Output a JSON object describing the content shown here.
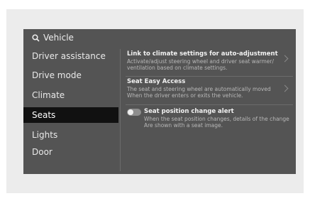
{
  "header": {
    "title": "Vehicle",
    "search_icon": "search-icon"
  },
  "sidebar": {
    "selected_index": 3,
    "items": [
      {
        "label": "Driver assistance"
      },
      {
        "label": "Drive mode"
      },
      {
        "label": "Climate"
      },
      {
        "label": "Seats"
      },
      {
        "label": "Lights"
      },
      {
        "label": "Door"
      }
    ]
  },
  "settings": [
    {
      "title": "Link to climate settings for auto-adjustment",
      "desc1": "Activate/adjust steering wheel and driver seat warmer/",
      "desc2": "ventilation based on climate settings.",
      "icon": "chevron-right-icon"
    },
    {
      "title": "Seat Easy Access",
      "desc1": "The seat and steering wheel are automatically moved",
      "desc2": "When the driver enters or exits the vehicle.",
      "icon": "chevron-right-icon"
    },
    {
      "title": "Seat position change alert",
      "desc1": "When the seat position changes, details of the change",
      "desc2": "Are shown with a seat image.",
      "toggle_on": false
    }
  ],
  "colors": {
    "screen_bg": "#545454",
    "selected_bg": "#111111",
    "text": "#eeeeee"
  }
}
